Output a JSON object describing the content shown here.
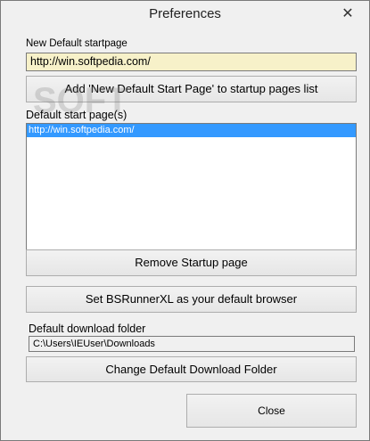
{
  "window": {
    "title": "Preferences",
    "close_glyph": "✕"
  },
  "startpage": {
    "label": "New Default startpage",
    "value": "http://win.softpedia.com/",
    "add_button": "Add 'New Default Start Page' to startup pages list"
  },
  "default_pages": {
    "label": "Default start page(s)",
    "items": [
      {
        "text": "http://win.softpedia.com/",
        "selected": true
      }
    ],
    "remove_button": "Remove Startup page"
  },
  "browser": {
    "set_default_button": "Set BSRunnerXL as your default browser"
  },
  "download": {
    "label": "Default download folder",
    "value": "C:\\Users\\IEUser\\Downloads",
    "change_button": "Change Default Download Folder"
  },
  "footer": {
    "close_button": "Close"
  },
  "colors": {
    "url_field_bg": "#f7f1c9",
    "selection": "#3399ff",
    "dialog_bg": "#f0f0f0"
  }
}
